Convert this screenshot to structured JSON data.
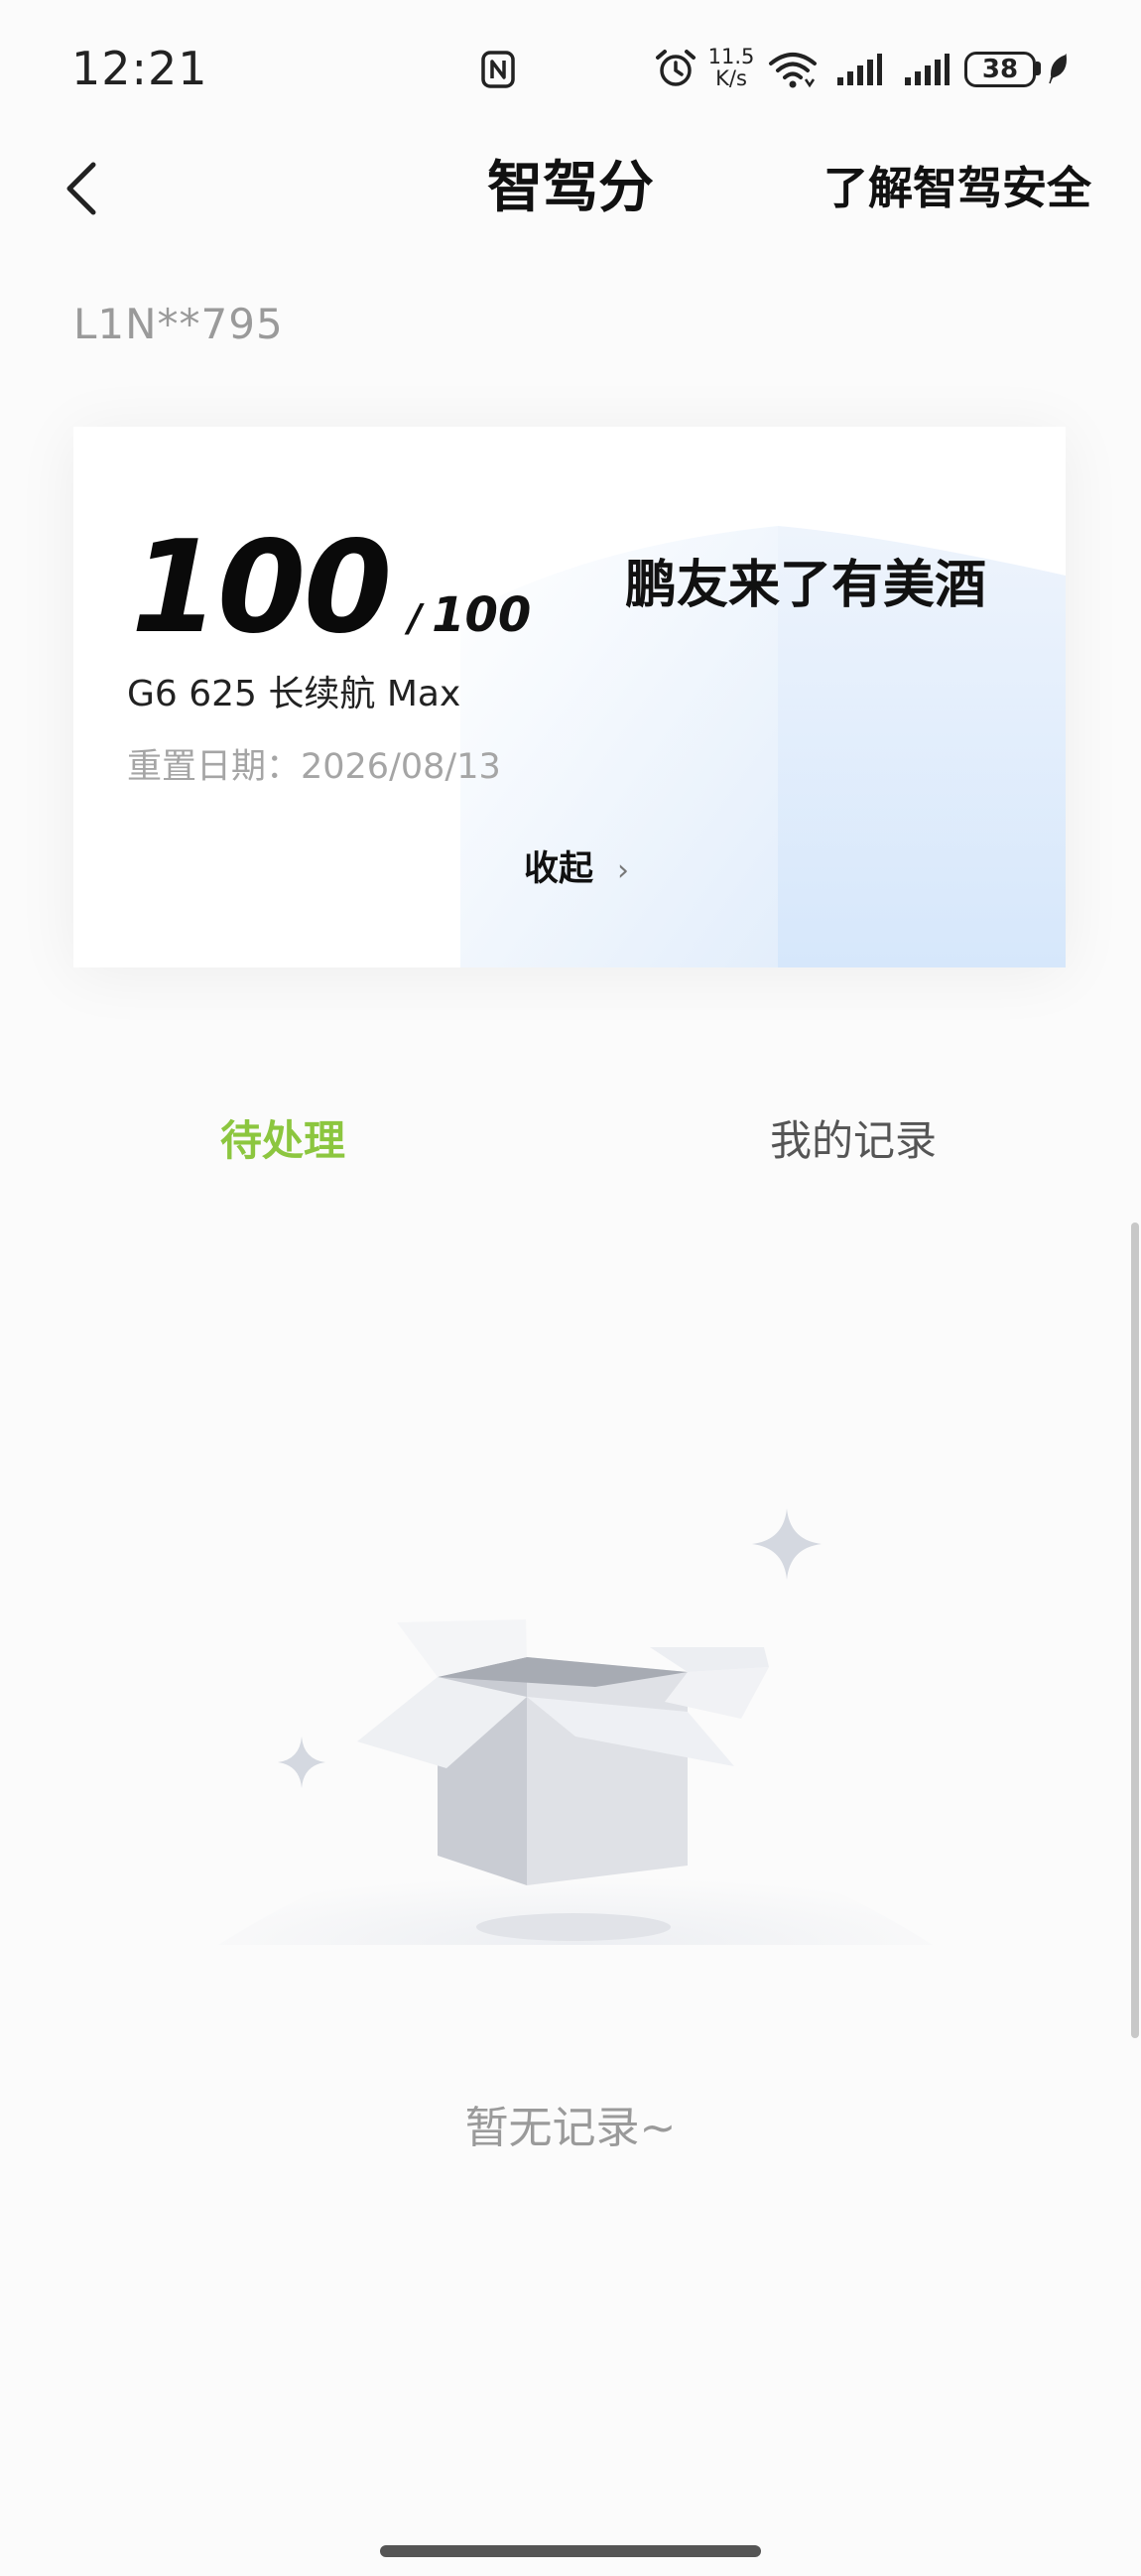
{
  "status_bar": {
    "time": "12:21",
    "net_speed_value": "11.5",
    "net_speed_unit": "K/s",
    "battery": "38",
    "icons": [
      "nfc-icon",
      "alarm-icon",
      "wifi-icon",
      "signal-icon",
      "signal-icon",
      "battery-icon",
      "leaf-icon"
    ]
  },
  "nav": {
    "back_icon": "chevron-left-icon",
    "title": "智驾分",
    "right_link": "了解智驾安全"
  },
  "plate": "L1N**795",
  "score_card": {
    "score": "100",
    "separator": "/",
    "total": "100",
    "slogan": "鹏友来了有美酒",
    "car_model": "G6 625 长续航 Max",
    "reset_date": "重置日期：2026/08/13",
    "collapse_label": "收起",
    "collapse_icon": "chevron-right-icon"
  },
  "tabs": [
    {
      "label": "待处理",
      "active": true
    },
    {
      "label": "我的记录",
      "active": false
    }
  ],
  "colors": {
    "accent": "#8cc63f"
  },
  "empty_state": {
    "illustration": "empty-box-illustration",
    "message": "暂无记录~"
  }
}
